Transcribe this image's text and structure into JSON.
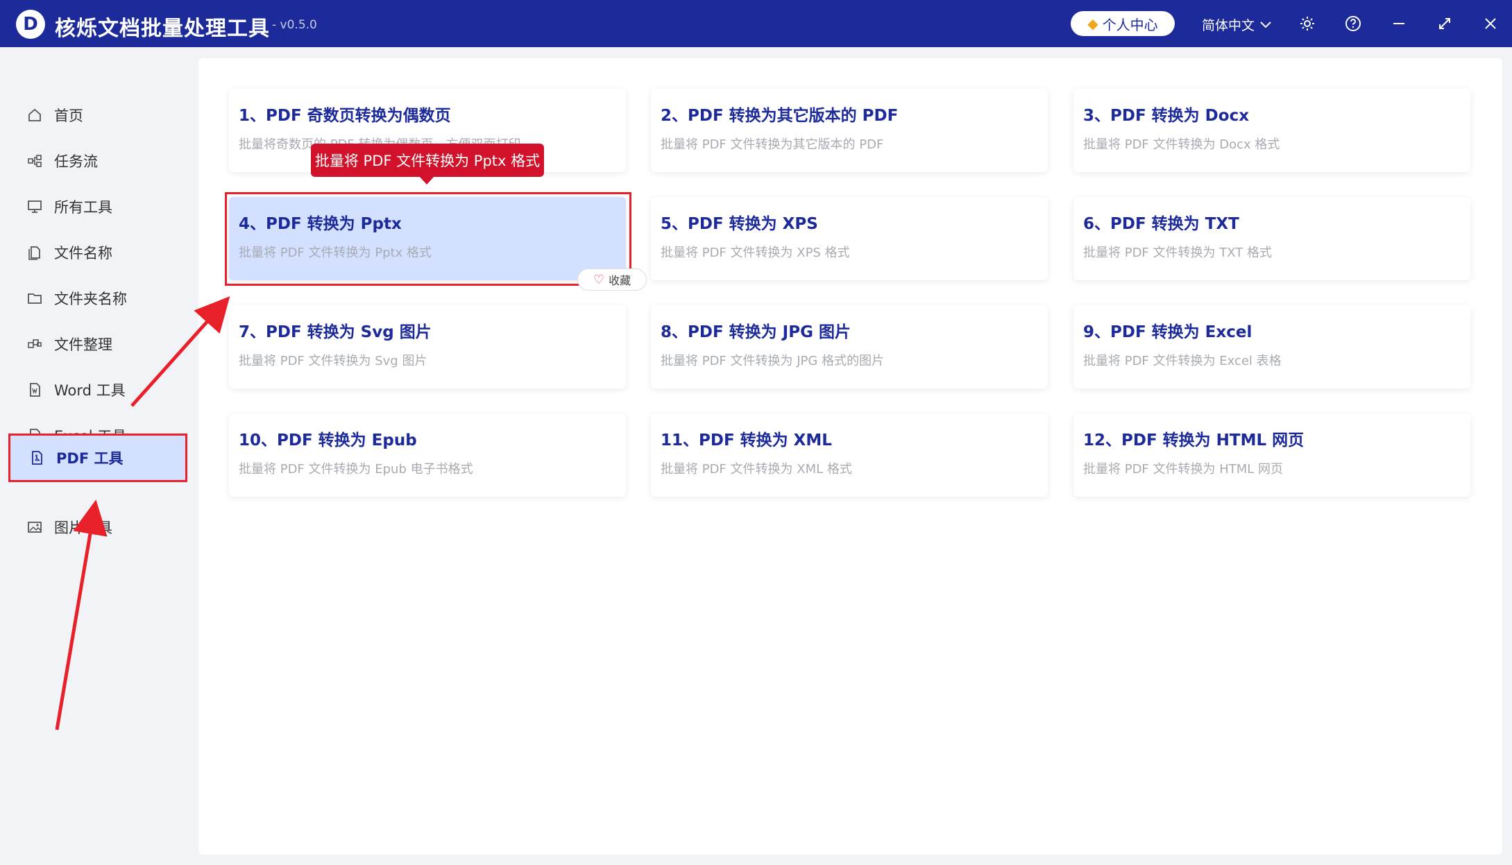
{
  "app": {
    "logo_letter": "D",
    "title": "核烁文档批量处理工具",
    "version": "- v0.5.0"
  },
  "titlebar": {
    "user_center_label": "个人中心",
    "language_label": "简体中文",
    "icons": [
      "gear-icon",
      "help-icon",
      "minimize-icon",
      "maximize-icon",
      "close-icon"
    ]
  },
  "sidebar": {
    "items": [
      {
        "label": "首页",
        "icon": "home-icon"
      },
      {
        "label": "任务流",
        "icon": "workflow-icon"
      },
      {
        "label": "所有工具",
        "icon": "monitor-icon"
      },
      {
        "label": "文件名称",
        "icon": "file-icon"
      },
      {
        "label": "文件夹名称",
        "icon": "folder-icon"
      },
      {
        "label": "文件整理",
        "icon": "organize-icon"
      },
      {
        "label": "Word 工具",
        "icon": "word-icon"
      },
      {
        "label": "Excel 工具",
        "icon": "excel-icon"
      },
      {
        "label": "PDF 工具",
        "icon": "pdf-icon",
        "active": true
      },
      {
        "label": "图片工具",
        "icon": "image-icon"
      }
    ]
  },
  "cards": [
    {
      "title": "1、PDF 奇数页转换为偶数页",
      "desc": "批量将奇数页的 PDF 转换为偶数页，方便双面打印"
    },
    {
      "title": "2、PDF 转换为其它版本的 PDF",
      "desc": "批量将 PDF 文件转换为其它版本的 PDF"
    },
    {
      "title": "3、PDF 转换为 Docx",
      "desc": "批量将 PDF 文件转换为 Docx 格式"
    },
    {
      "title": "4、PDF 转换为 Pptx",
      "desc": "批量将 PDF 文件转换为 Pptx 格式"
    },
    {
      "title": "5、PDF 转换为 XPS",
      "desc": "批量将 PDF 文件转换为 XPS 格式"
    },
    {
      "title": "6、PDF 转换为 TXT",
      "desc": "批量将 PDF 文件转换为 TXT 格式"
    },
    {
      "title": "7、PDF 转换为 Svg 图片",
      "desc": "批量将 PDF 文件转换为 Svg 图片"
    },
    {
      "title": "8、PDF 转换为 JPG 图片",
      "desc": "批量将 PDF 文件转换为 JPG 格式的图片"
    },
    {
      "title": "9、PDF 转换为 Excel",
      "desc": "批量将 PDF 文件转换为 Excel 表格"
    },
    {
      "title": "10、PDF 转换为 Epub",
      "desc": "批量将 PDF 文件转换为 Epub 电子书格式"
    },
    {
      "title": "11、PDF 转换为 XML",
      "desc": "批量将 PDF 文件转换为 XML 格式"
    },
    {
      "title": "12、PDF 转换为 HTML 网页",
      "desc": "批量将 PDF 文件转换为 HTML 网页"
    }
  ],
  "tooltip": "批量将 PDF 文件转换为 Pptx 格式",
  "favorite_label": "收藏",
  "colors": {
    "titlebar": "#1c2a9a",
    "accent": "#1c2a9a",
    "selected_bg": "#d3e0ff",
    "annotation_red": "#e8202a",
    "tooltip_bg": "#d1122a"
  }
}
